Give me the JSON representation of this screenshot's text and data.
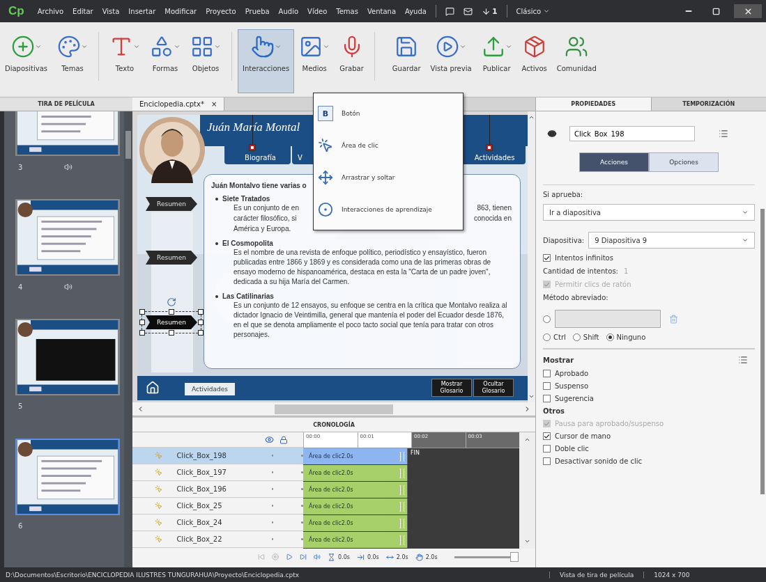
{
  "app": {
    "logo": "Cp",
    "menus": [
      "Archivo",
      "Editar",
      "Vista",
      "Insertar",
      "Modificar",
      "Proyecto",
      "Prueba",
      "Audio",
      "Vídeo",
      "Temas",
      "Ventana",
      "Ayuda"
    ],
    "notification_count": "1",
    "workspace": "Clásico"
  },
  "toolbar": [
    {
      "label": "Diapositivas",
      "dropdown": true,
      "selected": false
    },
    {
      "label": "Temas",
      "dropdown": true,
      "selected": false
    },
    {
      "label": "Texto",
      "dropdown": true,
      "selected": false
    },
    {
      "label": "Formas",
      "dropdown": true,
      "selected": false
    },
    {
      "label": "Objetos",
      "dropdown": true,
      "selected": false
    },
    {
      "label": "Interacciones",
      "dropdown": true,
      "selected": true
    },
    {
      "label": "Medios",
      "dropdown": true,
      "selected": false
    },
    {
      "label": "Grabar",
      "dropdown": false,
      "selected": false
    },
    {
      "label": "Guardar",
      "dropdown": false,
      "selected": false
    },
    {
      "label": "Vista previa",
      "dropdown": true,
      "selected": false
    },
    {
      "label": "Publicar",
      "dropdown": true,
      "selected": false
    },
    {
      "label": "Activos",
      "dropdown": false,
      "selected": false
    },
    {
      "label": "Comunidad",
      "dropdown": false,
      "selected": false
    }
  ],
  "interactions_menu": [
    {
      "label": "Botón",
      "glyph": "B"
    },
    {
      "label": "Área de clic"
    },
    {
      "label": "Arrastrar y soltar"
    },
    {
      "label": "Interacciones de aprendizaje"
    }
  ],
  "filmstrip": {
    "title": "TIRA DE PELÍCULA",
    "slides": [
      {
        "number": "3",
        "audio": true,
        "selected": false
      },
      {
        "number": "4",
        "audio": true,
        "selected": false
      },
      {
        "number": "5",
        "audio": false,
        "selected": false
      },
      {
        "number": "6",
        "audio": false,
        "selected": true
      }
    ]
  },
  "document_tab": {
    "title": "Enciclopedia.cptx*",
    "close": "×"
  },
  "slide": {
    "title": "Juán María Montal",
    "tabs": [
      {
        "label": "Biografía"
      },
      {
        "label": "V"
      },
      {
        "label": "Actividades"
      }
    ],
    "side_buttons": [
      {
        "label": "Resumen",
        "selected": false
      },
      {
        "label": "Resumen",
        "selected": false
      },
      {
        "label": "Resumen",
        "selected": true
      }
    ],
    "intro": "Juán Montalvo tiene varias o",
    "items": [
      {
        "title": "Siete Tratados",
        "lines": [
          [
            "Es un conjunto de en",
            "863, tienen"
          ],
          [
            "carácter filosófico, si",
            "conocida en"
          ],
          [
            "América y Europa."
          ]
        ]
      },
      {
        "title": "El Cosmopolita",
        "text": "Es el nombre de una revista de enfoque político, periodístico y ensayístico, fueron publicadas entre 1866 y 1869 y es considerada como una de las primeras obras de ensayo moderno de hispanoamérica, destaca en esta la \"Carta de un padre joven\", dedicada a su hija María del Carmen."
      },
      {
        "title": "Las Catilinarias",
        "text": "Es un conjunto de 12 ensayos, su enfoque se centra en la crítica que Montalvo realiza al dictador Ignacio de Veintimilla, general que mantenía el poder del Ecuador desde 1876, en el que se denota ampliamente el poco tacto social que tenía para tratar con otros personajes."
      }
    ],
    "activities_button": "Actividades",
    "glossary_buttons": [
      "Mostrar Glosario",
      "Ocultar Glosario"
    ]
  },
  "timeline": {
    "title": "CRONOLOGÍA",
    "ruler": [
      "00:00",
      "00:01",
      "00:02",
      "00:03"
    ],
    "rows": [
      {
        "name": "Click_Box_198",
        "bar": "Área de clic2.0s",
        "selected": true
      },
      {
        "name": "Click_Box_197",
        "bar": "Área de clic2.0s",
        "selected": false
      },
      {
        "name": "Click_Box_196",
        "bar": "Área de clic2.0s",
        "selected": false
      },
      {
        "name": "Click_Box_25",
        "bar": "Área de clic2.0s",
        "selected": false
      },
      {
        "name": "Click_Box_24",
        "bar": "Área de clic2.0s",
        "selected": false
      },
      {
        "name": "Click_Box_22",
        "bar": "Área de clic2.0s",
        "selected": false
      }
    ],
    "end_label": "FIN",
    "times": [
      "0.0s",
      "0.0s",
      "2.0s",
      "2.0s"
    ],
    "zoom": {
      "level": 1
    }
  },
  "properties": {
    "tabs": [
      {
        "label": "PROPIEDADES",
        "selected": true
      },
      {
        "label": "TEMPORIZACIÓN",
        "selected": false
      }
    ],
    "name": "Click_Box_198",
    "subtabs": [
      {
        "label": "Acciones",
        "selected": true
      },
      {
        "label": "Opciones",
        "selected": false
      }
    ],
    "on_success_label": "Si aprueba:",
    "on_success": "Ir a diapositiva",
    "slide_label": "Diapositiva:",
    "slide_value": "9 Diapositiva 9",
    "infinite_attempts": {
      "label": "Intentos infinitos",
      "checked": true,
      "disabled": false
    },
    "attempts_label": "Cantidad de intentos:",
    "attempts": "1",
    "allow_mouse": {
      "label": "Permitir clics de ratón",
      "checked": true,
      "disabled": true
    },
    "shortcut_label": "Método abreviado:",
    "shortcut_checked": false,
    "modifiers": [
      {
        "label": "Ctrl",
        "selected": false
      },
      {
        "label": "Shift",
        "selected": false
      },
      {
        "label": "Ninguno",
        "selected": true
      }
    ],
    "show_title": "Mostrar",
    "show": [
      {
        "label": "Aprobado",
        "checked": false,
        "disabled": false
      },
      {
        "label": "Suspenso",
        "checked": false,
        "disabled": false
      },
      {
        "label": "Sugerencia",
        "checked": false,
        "disabled": false
      }
    ],
    "others_title": "Otros",
    "others": [
      {
        "label": "Pausa para aprobado/suspenso",
        "checked": true,
        "disabled": true
      },
      {
        "label": "Cursor de mano",
        "checked": true,
        "disabled": false
      },
      {
        "label": "Doble clic",
        "checked": false,
        "disabled": false
      },
      {
        "label": "Desactivar sonido de clic",
        "checked": false,
        "disabled": false
      }
    ]
  },
  "status_bar": {
    "path": "D:\\Documentos\\Escritorio\\ENCICLOPEDIA ILUSTRES TUNGURAHUA\\Proyecto\\Enciclopedia.cptx",
    "view": "Vista de tira de película",
    "size": "1024 x 700"
  }
}
